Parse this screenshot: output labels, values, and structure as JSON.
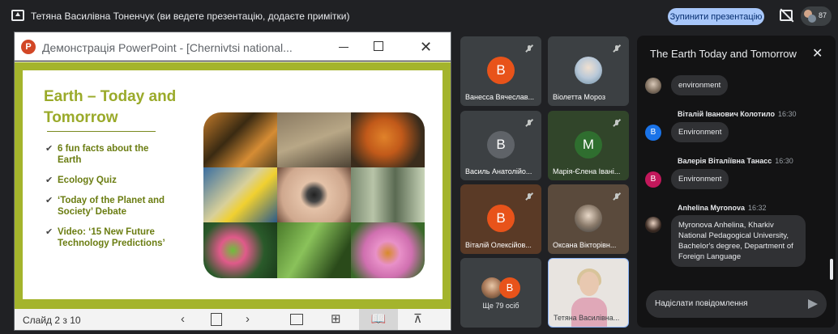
{
  "topbar": {
    "title": "Тетяна Василівна Тоненчук (ви ведете презентацію, додаєте примітки)",
    "stop_button": "Зупинити презентацію",
    "participants_count": "87"
  },
  "powerpoint": {
    "window_title": "Демонстрація PowerPoint - [Chernivtsi national...",
    "app_letter": "P",
    "slide": {
      "title": "Earth – Today and Tomorrow",
      "bullets": [
        "6 fun facts about the Earth",
        "Ecology Quiz",
        "‘Today of the Planet and Society’ Debate",
        "Video: ‘15 New Future Technology Predictions’"
      ]
    },
    "status": {
      "slide_counter": "Слайд 2 з 10"
    }
  },
  "participants": [
    {
      "name": "Ванесса Вячеслав...",
      "initial": "В",
      "avatar_color": "#e8531a"
    },
    {
      "name": "Віолетта Мороз",
      "initial": "",
      "avatar_color": ""
    },
    {
      "name": "Василь Анатолійо...",
      "initial": "В",
      "avatar_color": "#4a4f5a"
    },
    {
      "name": "Марія-Єлена Івані...",
      "initial": "М",
      "avatar_color": "#2f6e2f"
    },
    {
      "name": "Віталій Олексійов...",
      "initial": "В",
      "avatar_color": "#e8531a"
    },
    {
      "name": "Оксана Вікторівн...",
      "initial": "",
      "avatar_color": ""
    }
  ],
  "more_participants": {
    "label": "Ще 79 осіб",
    "initial": "В"
  },
  "self_tile": {
    "name": "Тетяна Василівна..."
  },
  "chat": {
    "title": "The Earth Today and Tomorrow",
    "messages": [
      {
        "sender": "",
        "time": "",
        "text": "environment"
      },
      {
        "sender": "Віталій Іванович Колотило",
        "time": "16:30",
        "text": "Environment",
        "initial": "В"
      },
      {
        "sender": "Валерія Віталіївна Танасс",
        "time": "16:30",
        "text": "Environment",
        "initial": "В"
      },
      {
        "sender": "Anhelina Myronova",
        "time": "16:32",
        "text": "Myronova Anhelina, Kharkiv National Pedagogical University, Bachelor's degree, Department of Foreign Language"
      }
    ],
    "input_placeholder": "Надіслати повідомлення"
  }
}
